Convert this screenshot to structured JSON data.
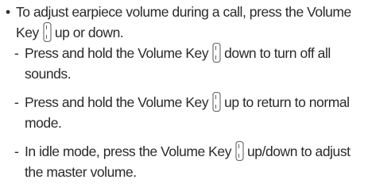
{
  "document": {
    "bullet_symbol": "•",
    "dash_symbol": "-",
    "icon": "volume-key-icon",
    "bullet": {
      "line1": "To adjust earpiece volume during a call, press the Volume",
      "line2_before": "Key",
      "line2_after": "up or down."
    },
    "sub_items": [
      {
        "line1_before": "Press and hold the Volume Key",
        "line1_after": "down to turn off all",
        "line2": "sounds."
      },
      {
        "line1_before": "Press and hold the Volume Key",
        "line1_after": "up to return to normal",
        "line2": "mode."
      },
      {
        "line1_before": "In idle mode, press the Volume Key",
        "line1_after": "up/down to adjust",
        "line2": "the master volume."
      }
    ]
  }
}
